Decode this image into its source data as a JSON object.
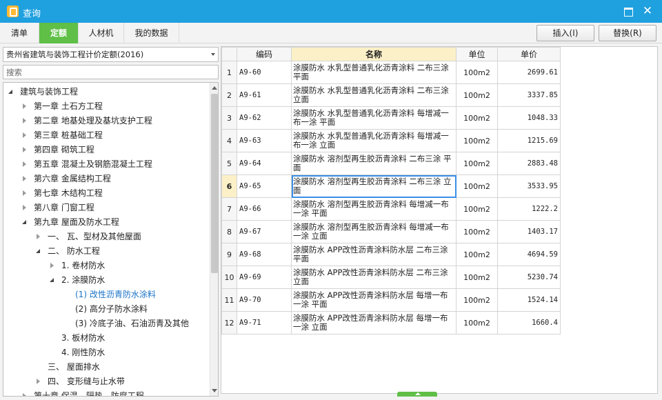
{
  "window": {
    "title": "查询",
    "icon": "app-logo-icon"
  },
  "tabs": [
    {
      "label": "清单",
      "active": false
    },
    {
      "label": "定额",
      "active": true
    },
    {
      "label": "人材机",
      "active": false
    },
    {
      "label": "我的数据",
      "active": false
    }
  ],
  "actions": {
    "insert_label": "插入(I)",
    "replace_label": "替换(R)"
  },
  "left_panel": {
    "quota_library": "贵州省建筑与装饰工程计价定额(2016)",
    "search_placeholder": "搜索",
    "tree": [
      {
        "label": "建筑与装饰工程",
        "state": "expanded",
        "level": 0
      },
      {
        "label": "第一章 土石方工程",
        "state": "collapsed",
        "level": 1
      },
      {
        "label": "第二章 地基处理及基坑支护工程",
        "state": "collapsed",
        "level": 1
      },
      {
        "label": "第三章 桩基础工程",
        "state": "collapsed",
        "level": 1
      },
      {
        "label": "第四章 砌筑工程",
        "state": "collapsed",
        "level": 1
      },
      {
        "label": "第五章 混凝土及钢筋混凝土工程",
        "state": "collapsed",
        "level": 1
      },
      {
        "label": "第六章 金属结构工程",
        "state": "collapsed",
        "level": 1
      },
      {
        "label": "第七章 木结构工程",
        "state": "collapsed",
        "level": 1
      },
      {
        "label": "第八章 门窗工程",
        "state": "collapsed",
        "level": 1
      },
      {
        "label": "第九章 屋面及防水工程",
        "state": "expanded",
        "level": 1
      },
      {
        "label": "一、 瓦、型材及其他屋面",
        "state": "collapsed",
        "level": 2
      },
      {
        "label": "二、 防水工程",
        "state": "expanded",
        "level": 2
      },
      {
        "label": "1. 卷材防水",
        "state": "collapsed",
        "level": 3
      },
      {
        "label": "2. 涂膜防水",
        "state": "expanded",
        "level": 3
      },
      {
        "label": "(1) 改性沥青防水涂料",
        "state": "leaf",
        "level": 4,
        "selected": true
      },
      {
        "label": "(2) 高分子防水涂料",
        "state": "leaf",
        "level": 4
      },
      {
        "label": "(3) 冷底子油、石油沥青及其他",
        "state": "leaf",
        "level": 4
      },
      {
        "label": "3. 板材防水",
        "state": "leaf",
        "level": 3
      },
      {
        "label": "4. 刚性防水",
        "state": "leaf",
        "level": 3
      },
      {
        "label": "三、 屋面排水",
        "state": "leaf",
        "level": 2
      },
      {
        "label": "四、 变形缝与止水带",
        "state": "collapsed",
        "level": 2
      },
      {
        "label": "第十章 保温、隔热、防腐工程",
        "state": "collapsed",
        "level": 1
      }
    ]
  },
  "grid": {
    "columns": [
      "编码",
      "名称",
      "单位",
      "单价"
    ],
    "current_row": 6,
    "rows": [
      {
        "no": "1",
        "code": "A9-60",
        "name": "涂膜防水 水乳型普通乳化沥青涂料 二布三涂 平面",
        "unit": "100m2",
        "price": "2699.61"
      },
      {
        "no": "2",
        "code": "A9-61",
        "name": "涂膜防水 水乳型普通乳化沥青涂料 二布三涂 立面",
        "unit": "100m2",
        "price": "3337.85"
      },
      {
        "no": "3",
        "code": "A9-62",
        "name": "涂膜防水 水乳型普通乳化沥青涂料 每增减一布一涂 平面",
        "unit": "100m2",
        "price": "1048.33"
      },
      {
        "no": "4",
        "code": "A9-63",
        "name": "涂膜防水 水乳型普通乳化沥青涂料 每增减一布一涂 立面",
        "unit": "100m2",
        "price": "1215.69"
      },
      {
        "no": "5",
        "code": "A9-64",
        "name": "涂膜防水 溶剂型再生胶沥青涂料 二布三涂 平面",
        "unit": "100m2",
        "price": "2883.48"
      },
      {
        "no": "6",
        "code": "A9-65",
        "name": "涂膜防水 溶剂型再生胶沥青涂料 二布三涂 立面",
        "unit": "100m2",
        "price": "3533.95"
      },
      {
        "no": "7",
        "code": "A9-66",
        "name": "涂膜防水 溶剂型再生胶沥青涂料 每增减一布一涂 平面",
        "unit": "100m2",
        "price": "1222.2"
      },
      {
        "no": "8",
        "code": "A9-67",
        "name": "涂膜防水 溶剂型再生胶沥青涂料 每增减一布一涂 立面",
        "unit": "100m2",
        "price": "1403.17"
      },
      {
        "no": "9",
        "code": "A9-68",
        "name": "涂膜防水 APP改性沥青涂料防水层 二布三涂 平面",
        "unit": "100m2",
        "price": "4694.59"
      },
      {
        "no": "10",
        "code": "A9-69",
        "name": "涂膜防水 APP改性沥青涂料防水层 二布三涂 立面",
        "unit": "100m2",
        "price": "5230.74"
      },
      {
        "no": "11",
        "code": "A9-70",
        "name": "涂膜防水 APP改性沥青涂料防水层 每增一布一涂 平面",
        "unit": "100m2",
        "price": "1524.14"
      },
      {
        "no": "12",
        "code": "A9-71",
        "name": "涂膜防水 APP改性沥青涂料防水层 每增一布一涂 立面",
        "unit": "100m2",
        "price": "1660.4"
      }
    ]
  },
  "colors": {
    "titlebar": "#1fa0df",
    "active_tab": "#5fbf47",
    "header_highlight": "#fbf0c7",
    "selected_tree_text": "#1a73c8",
    "current_cell_border": "#3a8ee6"
  }
}
